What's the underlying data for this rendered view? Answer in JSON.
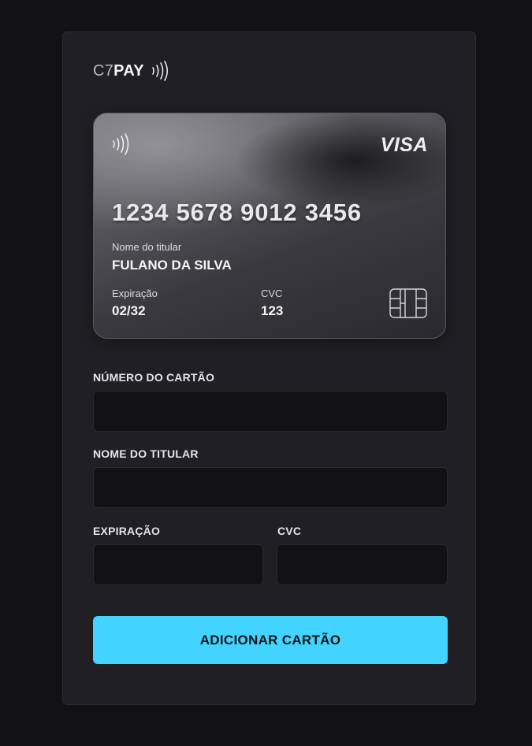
{
  "brand": {
    "logo_prefix": "C7",
    "logo_suffix": "PAY",
    "logo_icon": "contactless-icon"
  },
  "card_preview": {
    "network": "VISA",
    "number": "1234 5678 9012 3456",
    "holder_label": "Nome do titular",
    "holder_name": "FULANO DA SILVA",
    "expiry_label": "Expiração",
    "expiry_value": "02/32",
    "cvc_label": "CVC",
    "cvc_value": "123",
    "icons": [
      "contactless-icon",
      "chip-icon"
    ]
  },
  "form": {
    "card_number_label": "NÚMERO DO CARTÃO",
    "card_number_value": "",
    "holder_label": "NOME DO TITULAR",
    "holder_value": "",
    "expiry_label": "EXPIRAÇÃO",
    "expiry_value": "",
    "cvc_label": "CVC",
    "cvc_value": "",
    "submit_label": "ADICIONAR CARTÃO"
  },
  "colors": {
    "background": "#121214",
    "panel": "#202024",
    "input_bg": "#121214",
    "accent": "#42d3ff",
    "text": "#e4e4e8"
  }
}
